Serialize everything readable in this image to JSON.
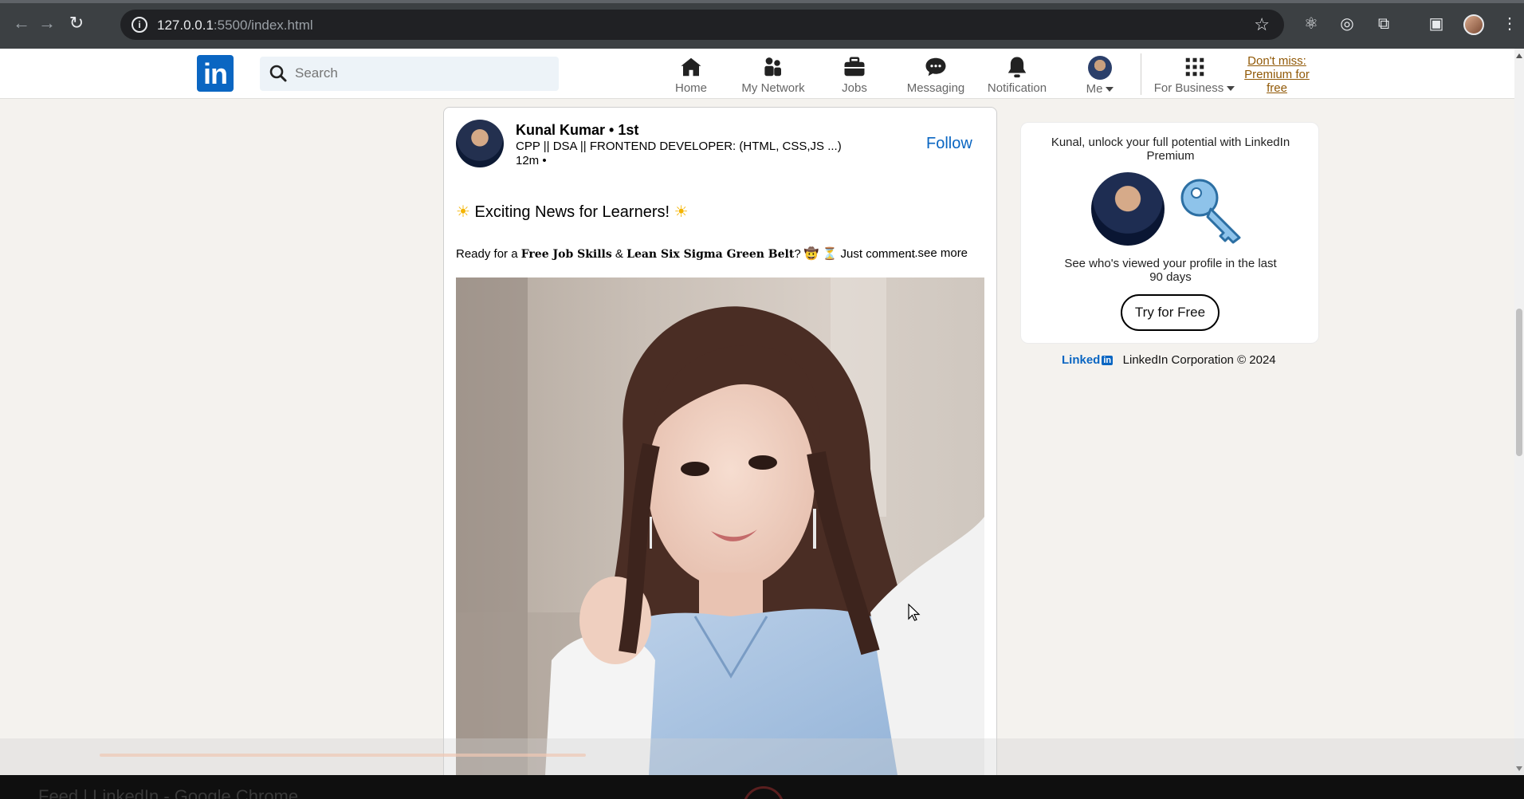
{
  "browser": {
    "url_host": "127.0.0.1",
    "url_path": ":5500/index.html"
  },
  "header": {
    "search_placeholder": "Search",
    "nav": [
      {
        "label": "Home"
      },
      {
        "label": "My Network"
      },
      {
        "label": "Jobs"
      },
      {
        "label": "Messaging"
      },
      {
        "label": "Notification"
      },
      {
        "label": "Me"
      },
      {
        "label": "For Business"
      }
    ],
    "premium_link": "Don't miss: Premium for free",
    "logo_text": "in"
  },
  "post": {
    "author": "Kunal Kumar • 1st",
    "subtitle": "CPP || DSA || FRONTEND DEVELOPER: (HTML, CSS,JS ...)",
    "time": "12m •",
    "follow_label": "Follow",
    "headline": "Exciting News for Learners!",
    "body_prefix": "Ready for a",
    "body_bold1": "Free Job Skills",
    "body_amp": "&",
    "body_bold2": "Lean Six Sigma Green Belt",
    "body_suffix": "? 🤠 ⏳ Just comment",
    "see_more": "...see more"
  },
  "premium": {
    "title": "Kunal, unlock your full potential with LinkedIn Premium",
    "description": "See who's viewed your profile in the last 90 days",
    "button": "Try for Free"
  },
  "footer": {
    "brand": "Linked",
    "brand_in": "in",
    "copyright": "LinkedIn Corporation © 2024"
  },
  "taskbar": {
    "title": "Feed | LinkedIn - Google Chrome"
  },
  "colors": {
    "linkedin_blue": "#0a66c2",
    "premium_gold": "#915907",
    "background": "#f4f2ee"
  }
}
